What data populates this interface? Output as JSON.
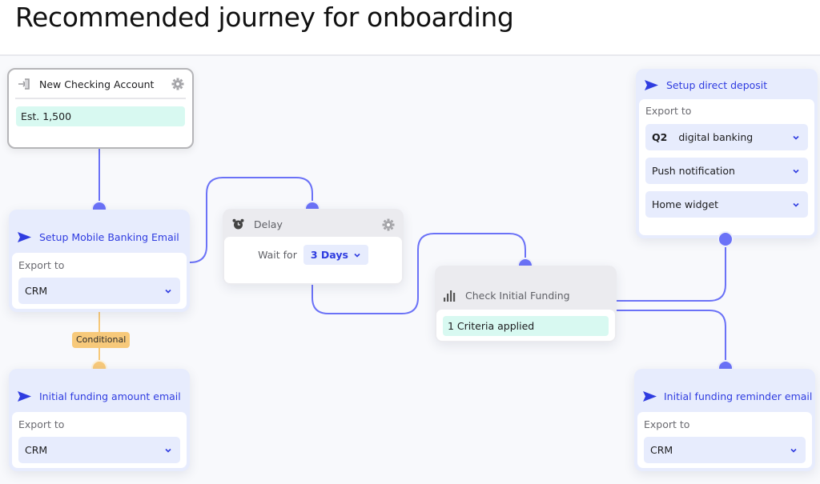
{
  "page": {
    "title": "Recommended journey for onboarding"
  },
  "colors": {
    "accent": "#2f3ce0",
    "connector": "#6b72f7",
    "conditional": "#f7c97a",
    "action_bg": "#e7ecfd",
    "estimate_bg": "#d8f9f1"
  },
  "nodes": {
    "trigger": {
      "icon": "enter-icon",
      "title": "New Checking Account",
      "settings_icon": "gear-icon",
      "estimate": "Est. 1,500"
    },
    "mobile_email": {
      "icon": "send-icon",
      "title": "Setup Mobile Banking Email",
      "export_label": "Export to",
      "select_value": "CRM"
    },
    "conditional_badge": "Conditional",
    "funding_amount_email": {
      "icon": "send-icon",
      "title": "Initial funding amount email",
      "export_label": "Export to",
      "select_value": "CRM"
    },
    "delay": {
      "icon": "alarm-clock-icon",
      "title": "Delay",
      "settings_icon": "gear-icon",
      "wait_label": "Wait for",
      "wait_value": "3 Days"
    },
    "check_funding": {
      "icon": "bar-chart-icon",
      "title": "Check Initial Funding",
      "criteria": "1 Criteria applied"
    },
    "direct_deposit": {
      "icon": "send-icon",
      "title": "Setup direct deposit",
      "export_label": "Export to",
      "selects": [
        {
          "logo": "Q2",
          "value": "digital banking"
        },
        {
          "value": "Push notification"
        },
        {
          "value": "Home widget"
        }
      ]
    },
    "reminder_email": {
      "icon": "send-icon",
      "title": "Initial funding reminder email",
      "export_label": "Export to",
      "select_value": "CRM"
    }
  }
}
